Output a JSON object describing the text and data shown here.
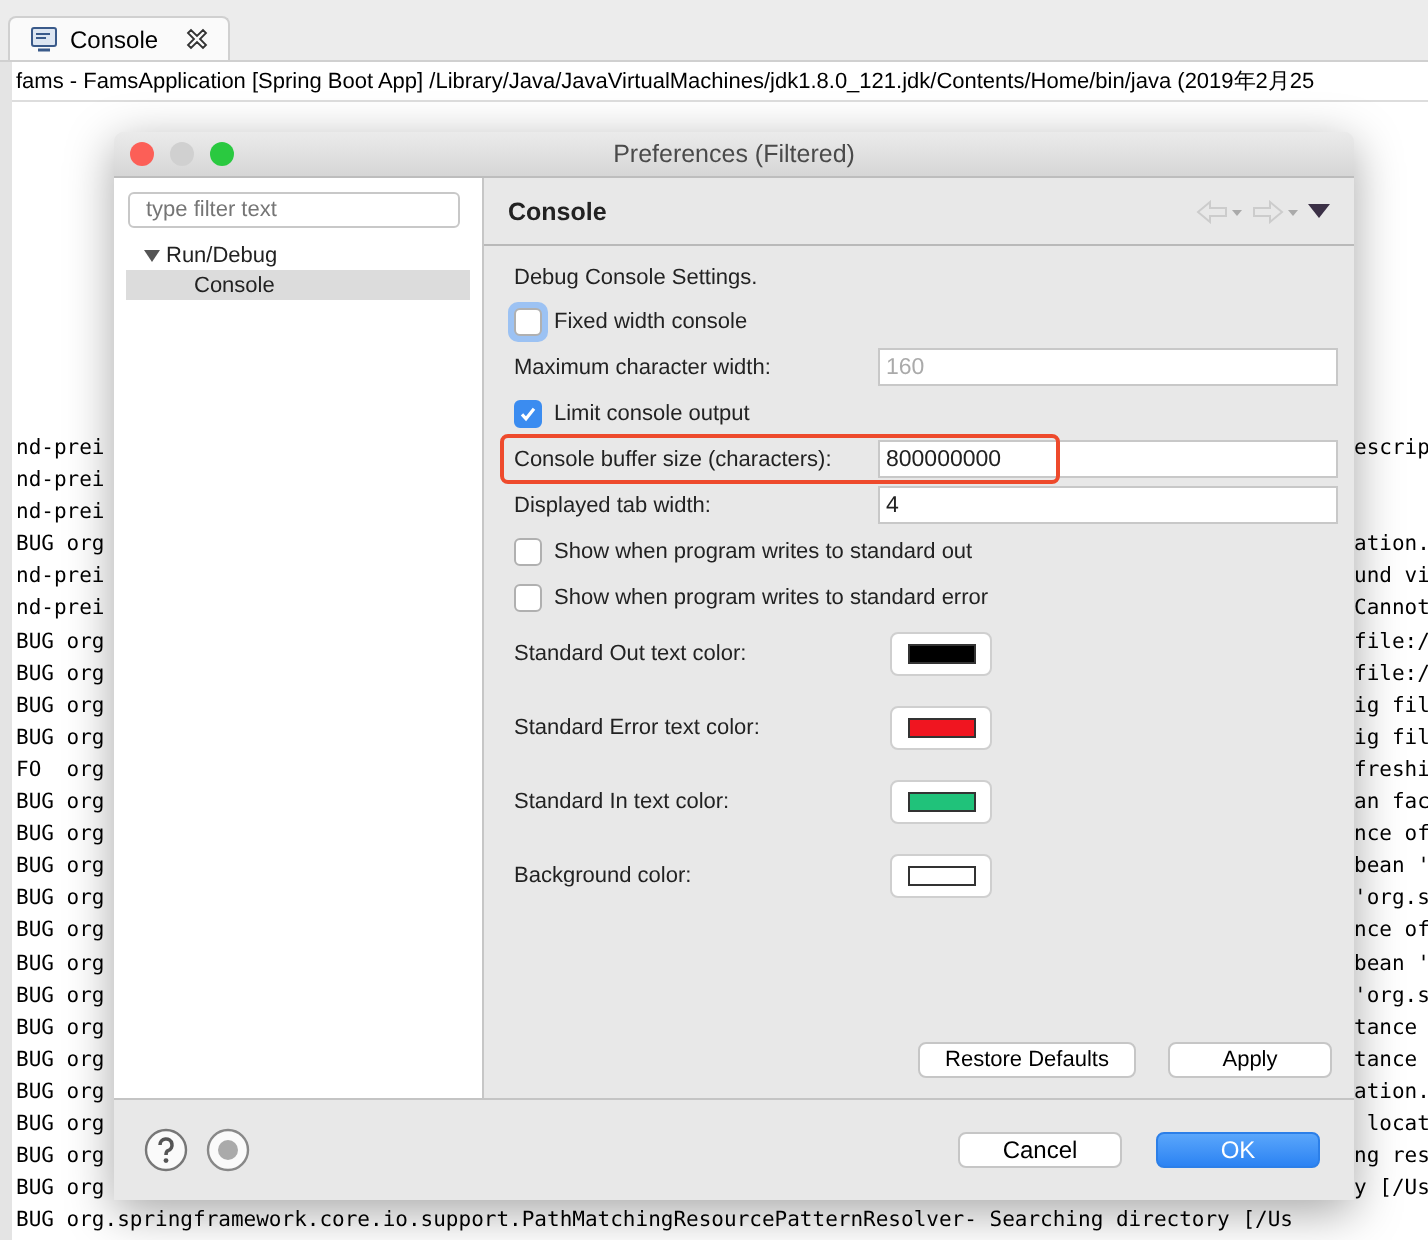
{
  "console_tab": {
    "label": "Console",
    "selected": true
  },
  "console_header": "fams - FamsApplication [Spring Boot App] /Library/Java/JavaVirtualMachines/jdk1.8.0_121.jdk/Contents/Home/bin/java (2019年2月25",
  "console_lines": [
    {
      "kind": "partial",
      "left": "nd-prei",
      "right": "escrip"
    },
    {
      "kind": "partial",
      "left": "nd-prei"
    },
    {
      "kind": "partial",
      "left": "nd-prei"
    },
    {
      "kind": "partial",
      "left": "BUG org",
      "right": "ation."
    },
    {
      "kind": "partial",
      "left": "nd-prei",
      "right": "und vi"
    },
    {
      "kind": "partial",
      "left": "nd-prei",
      "right": "Cannot"
    },
    {
      "kind": "partial",
      "left": "BUG org",
      "right": "file:/"
    },
    {
      "kind": "partial",
      "left": "BUG org",
      "right": "file:/"
    },
    {
      "kind": "partial",
      "left": "BUG org",
      "right": "ig fil"
    },
    {
      "kind": "partial",
      "left": "BUG org",
      "right": "ig fil"
    },
    {
      "kind": "partial",
      "left": "FO  org",
      "right": "freshi"
    },
    {
      "kind": "partial",
      "left": "BUG org",
      "right": "an fac"
    },
    {
      "kind": "partial",
      "left": "BUG org",
      "right": "nce of"
    },
    {
      "kind": "partial",
      "left": "BUG org",
      "right": "bean '"
    },
    {
      "kind": "partial",
      "left": "BUG org",
      "right": "'org.s"
    },
    {
      "kind": "partial",
      "left": "BUG org",
      "right": "nce of"
    },
    {
      "kind": "partial",
      "left": "BUG org",
      "right": "bean '"
    },
    {
      "kind": "partial",
      "left": "BUG org",
      "right": "'org.s"
    },
    {
      "kind": "partial",
      "left": "BUG org",
      "right": "tance"
    },
    {
      "kind": "partial",
      "left": "BUG org",
      "right": "tance"
    },
    {
      "kind": "partial",
      "left": "BUG org",
      "right": "ation."
    },
    {
      "kind": "partial",
      "left": "BUG org",
      "right": " locat"
    },
    {
      "kind": "partial",
      "left": "BUG org",
      "right": "ng res"
    },
    {
      "kind": "partial",
      "left": "BUG org",
      "right": "y [/Us"
    },
    {
      "kind": "full",
      "text": "BUG org.springframework.core.io.support.PathMatchingResourcePatternResolver- Searching directory [/Us"
    }
  ],
  "dialog": {
    "title": "Preferences (Filtered)",
    "filter": {
      "placeholder": "type filter text"
    },
    "tree": [
      {
        "label": "Run/Debug",
        "expanded": true,
        "selected": false,
        "children": [
          {
            "label": "Console",
            "selected": true
          }
        ]
      }
    ],
    "page_title": "Console",
    "section_label": "Debug Console Settings.",
    "settings": [
      {
        "kind": "checkbox",
        "label": "Fixed width console",
        "checked": false,
        "focused": true
      },
      {
        "kind": "field",
        "label": "Maximum character width:",
        "value": "160",
        "disabled": true,
        "highlighted": false
      },
      {
        "kind": "checkbox",
        "label": "Limit console output",
        "checked": true,
        "focused": false
      },
      {
        "kind": "field",
        "label": "Console buffer size (characters):",
        "value": "800000000",
        "disabled": false,
        "highlighted": true
      },
      {
        "kind": "field",
        "label": "Displayed tab width:",
        "value": "4",
        "disabled": false,
        "highlighted": false
      },
      {
        "kind": "checkbox",
        "label": "Show when program writes to standard out",
        "checked": false,
        "focused": false
      },
      {
        "kind": "checkbox",
        "label": "Show when program writes to standard error",
        "checked": false,
        "focused": false
      }
    ],
    "colors": [
      {
        "label": "Standard Out text color:",
        "color": "#000000"
      },
      {
        "label": "Standard Error text color:",
        "color": "#f01520"
      },
      {
        "label": "Standard In text color:",
        "color": "#20c27a"
      },
      {
        "label": "Background color:",
        "color": "#ffffff"
      }
    ],
    "page_buttons": [
      "Restore Defaults",
      "Apply"
    ],
    "buttons": [
      {
        "label": "Cancel",
        "default": false
      },
      {
        "label": "OK",
        "default": true
      }
    ]
  }
}
